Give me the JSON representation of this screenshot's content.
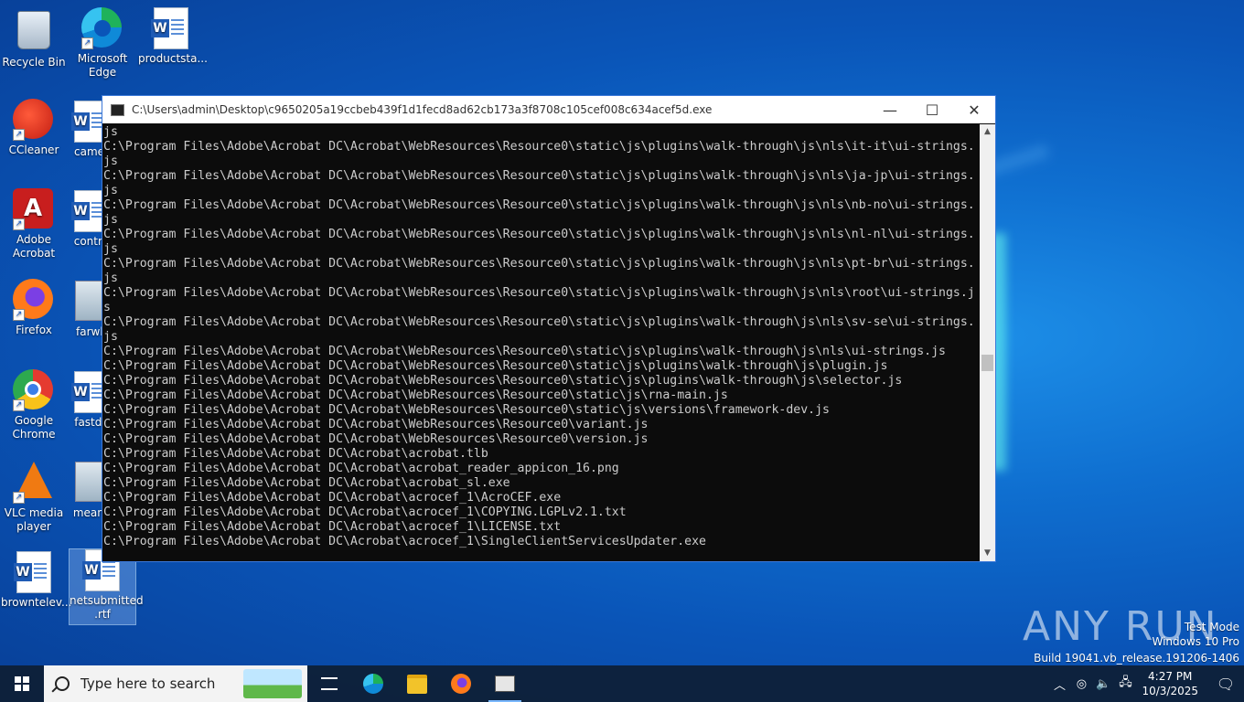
{
  "desktop": {
    "icons_left": [
      {
        "label": "Recycle Bin"
      },
      {
        "label": "CCleaner"
      },
      {
        "label": "Adobe Acrobat"
      },
      {
        "label": "Firefox"
      },
      {
        "label": "Google Chrome"
      },
      {
        "label": "VLC media player"
      },
      {
        "label": "browntelev..."
      }
    ],
    "icons_col2": [
      {
        "label": "Microsoft Edge"
      },
      {
        "label": "camer"
      },
      {
        "label": "contra"
      },
      {
        "label": "farwh"
      },
      {
        "label": "fastde"
      },
      {
        "label": "means"
      },
      {
        "label": "netsubmitted .rtf"
      }
    ],
    "icons_col3": [
      {
        "label": "productsta..."
      }
    ]
  },
  "console": {
    "title": "C:\\Users\\admin\\Desktop\\c9650205a19ccbeb439f1d1fecd8ad62cb173a3f8708c105cef008c634acef5d.exe",
    "lines": [
      "js",
      "C:\\Program Files\\Adobe\\Acrobat DC\\Acrobat\\WebResources\\Resource0\\static\\js\\plugins\\walk-through\\js\\nls\\it-it\\ui-strings.",
      "js",
      "C:\\Program Files\\Adobe\\Acrobat DC\\Acrobat\\WebResources\\Resource0\\static\\js\\plugins\\walk-through\\js\\nls\\ja-jp\\ui-strings.",
      "js",
      "C:\\Program Files\\Adobe\\Acrobat DC\\Acrobat\\WebResources\\Resource0\\static\\js\\plugins\\walk-through\\js\\nls\\nb-no\\ui-strings.",
      "js",
      "C:\\Program Files\\Adobe\\Acrobat DC\\Acrobat\\WebResources\\Resource0\\static\\js\\plugins\\walk-through\\js\\nls\\nl-nl\\ui-strings.",
      "js",
      "C:\\Program Files\\Adobe\\Acrobat DC\\Acrobat\\WebResources\\Resource0\\static\\js\\plugins\\walk-through\\js\\nls\\pt-br\\ui-strings.",
      "js",
      "C:\\Program Files\\Adobe\\Acrobat DC\\Acrobat\\WebResources\\Resource0\\static\\js\\plugins\\walk-through\\js\\nls\\root\\ui-strings.j",
      "s",
      "C:\\Program Files\\Adobe\\Acrobat DC\\Acrobat\\WebResources\\Resource0\\static\\js\\plugins\\walk-through\\js\\nls\\sv-se\\ui-strings.",
      "js",
      "C:\\Program Files\\Adobe\\Acrobat DC\\Acrobat\\WebResources\\Resource0\\static\\js\\plugins\\walk-through\\js\\nls\\ui-strings.js",
      "C:\\Program Files\\Adobe\\Acrobat DC\\Acrobat\\WebResources\\Resource0\\static\\js\\plugins\\walk-through\\js\\plugin.js",
      "C:\\Program Files\\Adobe\\Acrobat DC\\Acrobat\\WebResources\\Resource0\\static\\js\\plugins\\walk-through\\js\\selector.js",
      "C:\\Program Files\\Adobe\\Acrobat DC\\Acrobat\\WebResources\\Resource0\\static\\js\\rna-main.js",
      "C:\\Program Files\\Adobe\\Acrobat DC\\Acrobat\\WebResources\\Resource0\\static\\js\\versions\\framework-dev.js",
      "C:\\Program Files\\Adobe\\Acrobat DC\\Acrobat\\WebResources\\Resource0\\variant.js",
      "C:\\Program Files\\Adobe\\Acrobat DC\\Acrobat\\WebResources\\Resource0\\version.js",
      "C:\\Program Files\\Adobe\\Acrobat DC\\Acrobat\\acrobat.tlb",
      "C:\\Program Files\\Adobe\\Acrobat DC\\Acrobat\\acrobat_reader_appicon_16.png",
      "C:\\Program Files\\Adobe\\Acrobat DC\\Acrobat\\acrobat_sl.exe",
      "C:\\Program Files\\Adobe\\Acrobat DC\\Acrobat\\acrocef_1\\AcroCEF.exe",
      "C:\\Program Files\\Adobe\\Acrobat DC\\Acrobat\\acrocef_1\\COPYING.LGPLv2.1.txt",
      "C:\\Program Files\\Adobe\\Acrobat DC\\Acrobat\\acrocef_1\\LICENSE.txt",
      "C:\\Program Files\\Adobe\\Acrobat DC\\Acrobat\\acrocef_1\\SingleClientServicesUpdater.exe"
    ]
  },
  "watermark": {
    "brand": "ANY RUN",
    "test_mode": "Test Mode",
    "os": "Windows 10 Pro",
    "build": "Build 19041.vb_release.191206-1406"
  },
  "taskbar": {
    "search_placeholder": "Type here to search",
    "time": "4:27 PM",
    "date": "10/3/2025"
  }
}
